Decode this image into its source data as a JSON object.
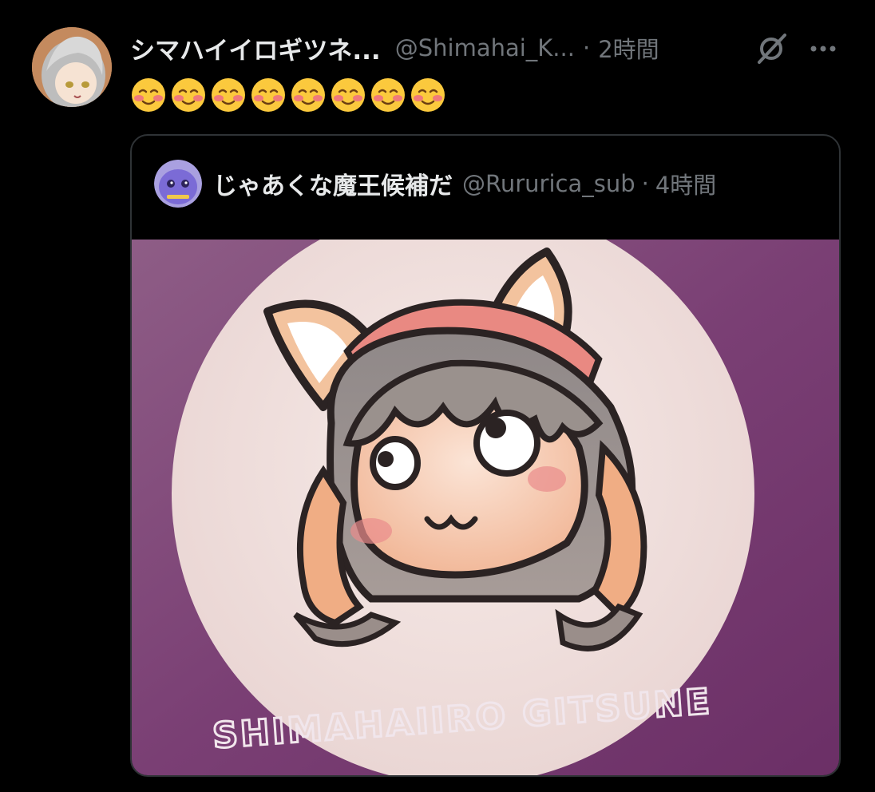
{
  "post": {
    "author_name": "シマハイイロギツネ...",
    "author_handle": "@Shimahai_K...",
    "separator": "·",
    "time": "2時間",
    "emoji_count": 8,
    "avatar_icon": "fox-girl-avatar",
    "grok_icon": "grok-icon",
    "more_icon": "more-icon"
  },
  "quoted": {
    "author_name": "じゃあくな魔王候補だ",
    "author_handle": "@Rururica_sub",
    "separator": "·",
    "time": "4時間",
    "avatar_icon": "purple-creature-avatar",
    "image_caption": "SHIMAHAIIRO GITSUNE"
  },
  "colors": {
    "background": "#000000",
    "text_primary": "#e7e9ea",
    "text_secondary": "#71767b",
    "quote_border": "#2f3336",
    "image_background": "#7a3f74"
  }
}
